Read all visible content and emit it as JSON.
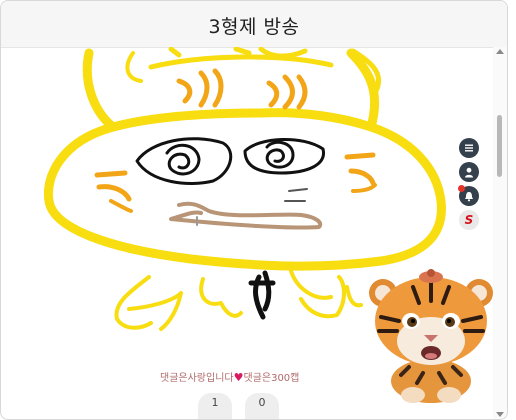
{
  "header": {
    "title": "3형제 방송"
  },
  "side_menu": [
    {
      "name": "list-button",
      "icon": "list-icon"
    },
    {
      "name": "profile-button",
      "icon": "person-icon"
    },
    {
      "name": "notification-button",
      "icon": "bell-icon"
    },
    {
      "name": "s-logo-button",
      "icon": "s-logo-icon",
      "text": "S"
    }
  ],
  "footer": {
    "comment_text_1": "댓글은사랑입니다",
    "heart": "♥",
    "comment_text_2": "댓글은300캡",
    "count_1": "1",
    "count_2": "0"
  },
  "colors": {
    "outline_yellow": "#f8dd10",
    "stripe_orange": "#f2a516",
    "mouth_brown": "#b89576",
    "dark_button": "#34404b"
  }
}
